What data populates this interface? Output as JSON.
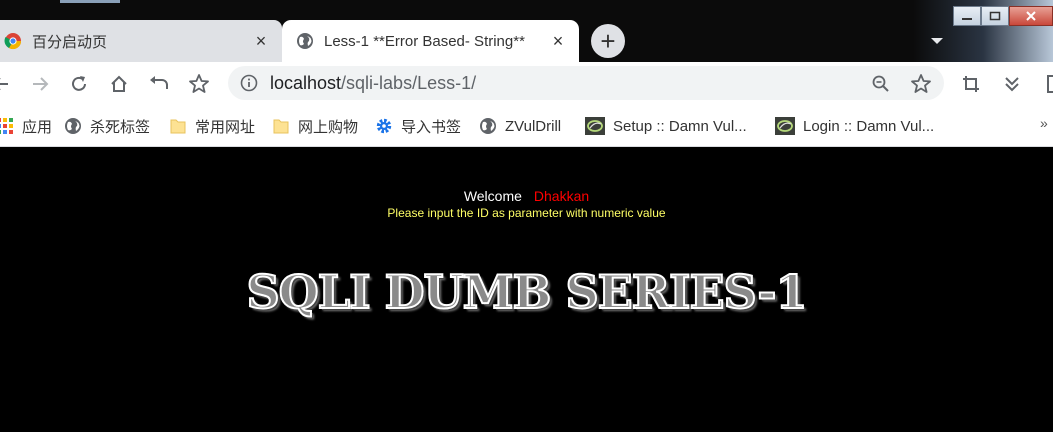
{
  "tabs": [
    {
      "title": "百分启动页",
      "close": "×",
      "active": false
    },
    {
      "title": "Less-1 **Error Based- String**",
      "close": "×",
      "active": true
    }
  ],
  "new_tab_label": "+",
  "toolbar": {
    "url_host": "localhost",
    "url_path": "/sqli-labs/Less-1/"
  },
  "bookmarks": [
    {
      "label": "应用",
      "icon": "apps-grid-icon"
    },
    {
      "label": "杀死标签",
      "icon": "globe-icon"
    },
    {
      "label": "常用网址",
      "icon": "folder-icon"
    },
    {
      "label": "网上购物",
      "icon": "folder-icon"
    },
    {
      "label": "导入书签",
      "icon": "gear-icon"
    },
    {
      "label": "ZVulDrill",
      "icon": "globe-icon"
    },
    {
      "label": "Setup :: Damn Vul...",
      "icon": "dvwa-icon"
    },
    {
      "label": "Login :: Damn Vul...",
      "icon": "dvwa-icon"
    }
  ],
  "bookmarks_more": "»",
  "page": {
    "welcome_label": "Welcome",
    "welcome_name": "Dhakkan",
    "hint": "Please input the ID as parameter with numeric value",
    "banner": "SQLI DUMB SERIES-1"
  },
  "colors": {
    "page_bg": "#000000",
    "welcome_name": "#ff0000",
    "hint": "#ffff66"
  }
}
